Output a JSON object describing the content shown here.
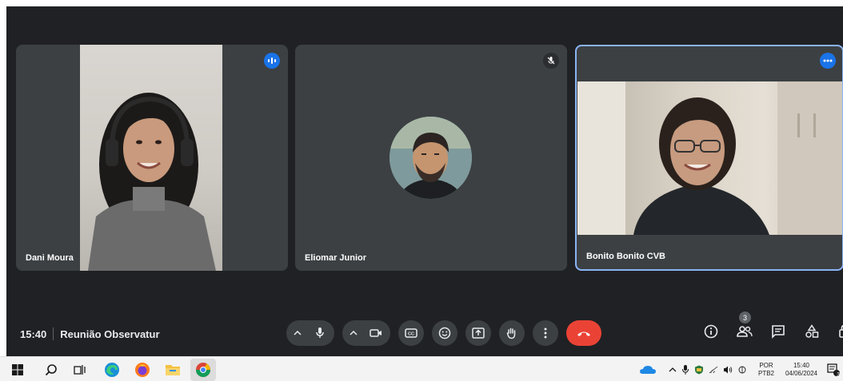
{
  "meeting": {
    "time": "15:40",
    "title": "Reunião Observatur"
  },
  "participants": [
    {
      "name": "Dani Moura",
      "status_icon": "speaking-icon"
    },
    {
      "name": "Eliomar Junior",
      "status_icon": "mic-off-icon"
    },
    {
      "name": "Bonito Bonito CVB",
      "status_icon": "more-options-icon"
    }
  ],
  "controls": {
    "mic": "mic-icon",
    "camera": "camera-icon",
    "captions": "captions-icon",
    "reactions": "emoji-icon",
    "present": "present-icon",
    "raise_hand": "raise-hand-icon",
    "more": "more-vert-icon",
    "leave": "end-call-icon"
  },
  "side_panel": {
    "people_count": "3"
  },
  "taskbar": {
    "language_top": "POR",
    "language_bottom": "PTB2",
    "clock_time": "15:40",
    "clock_date": "04/06/2024",
    "notification_count": "3"
  },
  "colors": {
    "meet_bg": "#202124",
    "tile_bg": "#3c4043",
    "accent_blue": "#1a73e8",
    "end_call_red": "#ea4335",
    "active_border": "#8ab4f8"
  }
}
